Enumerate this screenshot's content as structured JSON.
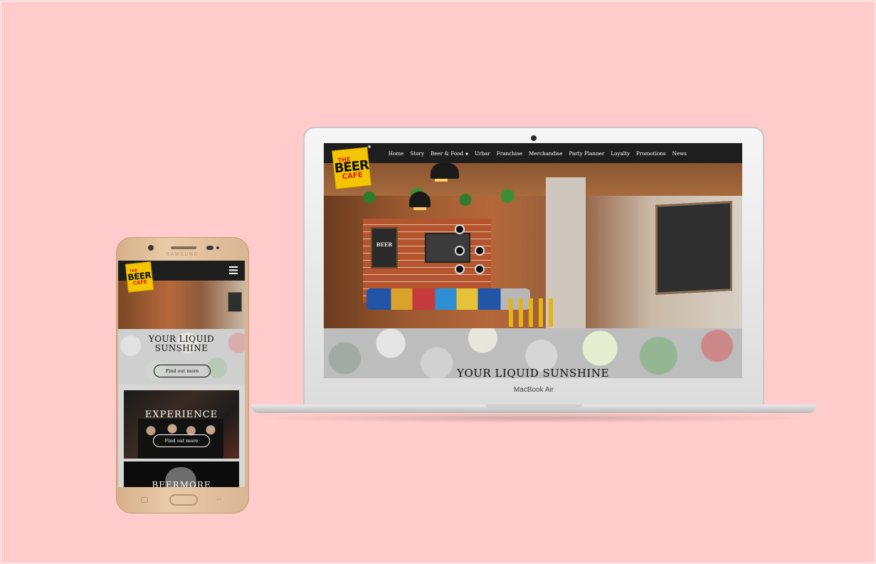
{
  "laptop": {
    "brand": "MacBook Air",
    "site": {
      "logo": {
        "line1": "THE",
        "line2": "BEER",
        "line3": "CAFE",
        "registered": "®"
      },
      "nav": [
        {
          "label": "Home"
        },
        {
          "label": "Story"
        },
        {
          "label": "Beer & Food",
          "caret": "▼"
        },
        {
          "label": "Urbar"
        },
        {
          "label": "Franchise"
        },
        {
          "label": "Merchandise"
        },
        {
          "label": "Party Planner"
        },
        {
          "label": "Loyalty"
        },
        {
          "label": "Promotions"
        },
        {
          "label": "News"
        }
      ],
      "poster_text": "BEER",
      "hero_title": "YOUR LIQUID SUNSHINE"
    }
  },
  "phone": {
    "brand": "SAMSUNG",
    "site": {
      "logo": {
        "line1": "THE",
        "line2": "BEER",
        "line3": "CAFE"
      },
      "menu_icon": "hamburger-icon",
      "section1": {
        "title_line1": "YOUR LIQUID",
        "title_line2": "SUNSHINE",
        "button": "Find out more"
      },
      "section2": {
        "title": "EXPERIENCE",
        "button": "Find out more"
      },
      "section3": {
        "title": "BEERMORE"
      }
    }
  },
  "colors": {
    "background": "#ffcbcb",
    "navbar": "#1e1e1e",
    "logo_yellow": "#f4c500",
    "logo_red": "#d41f1f"
  }
}
